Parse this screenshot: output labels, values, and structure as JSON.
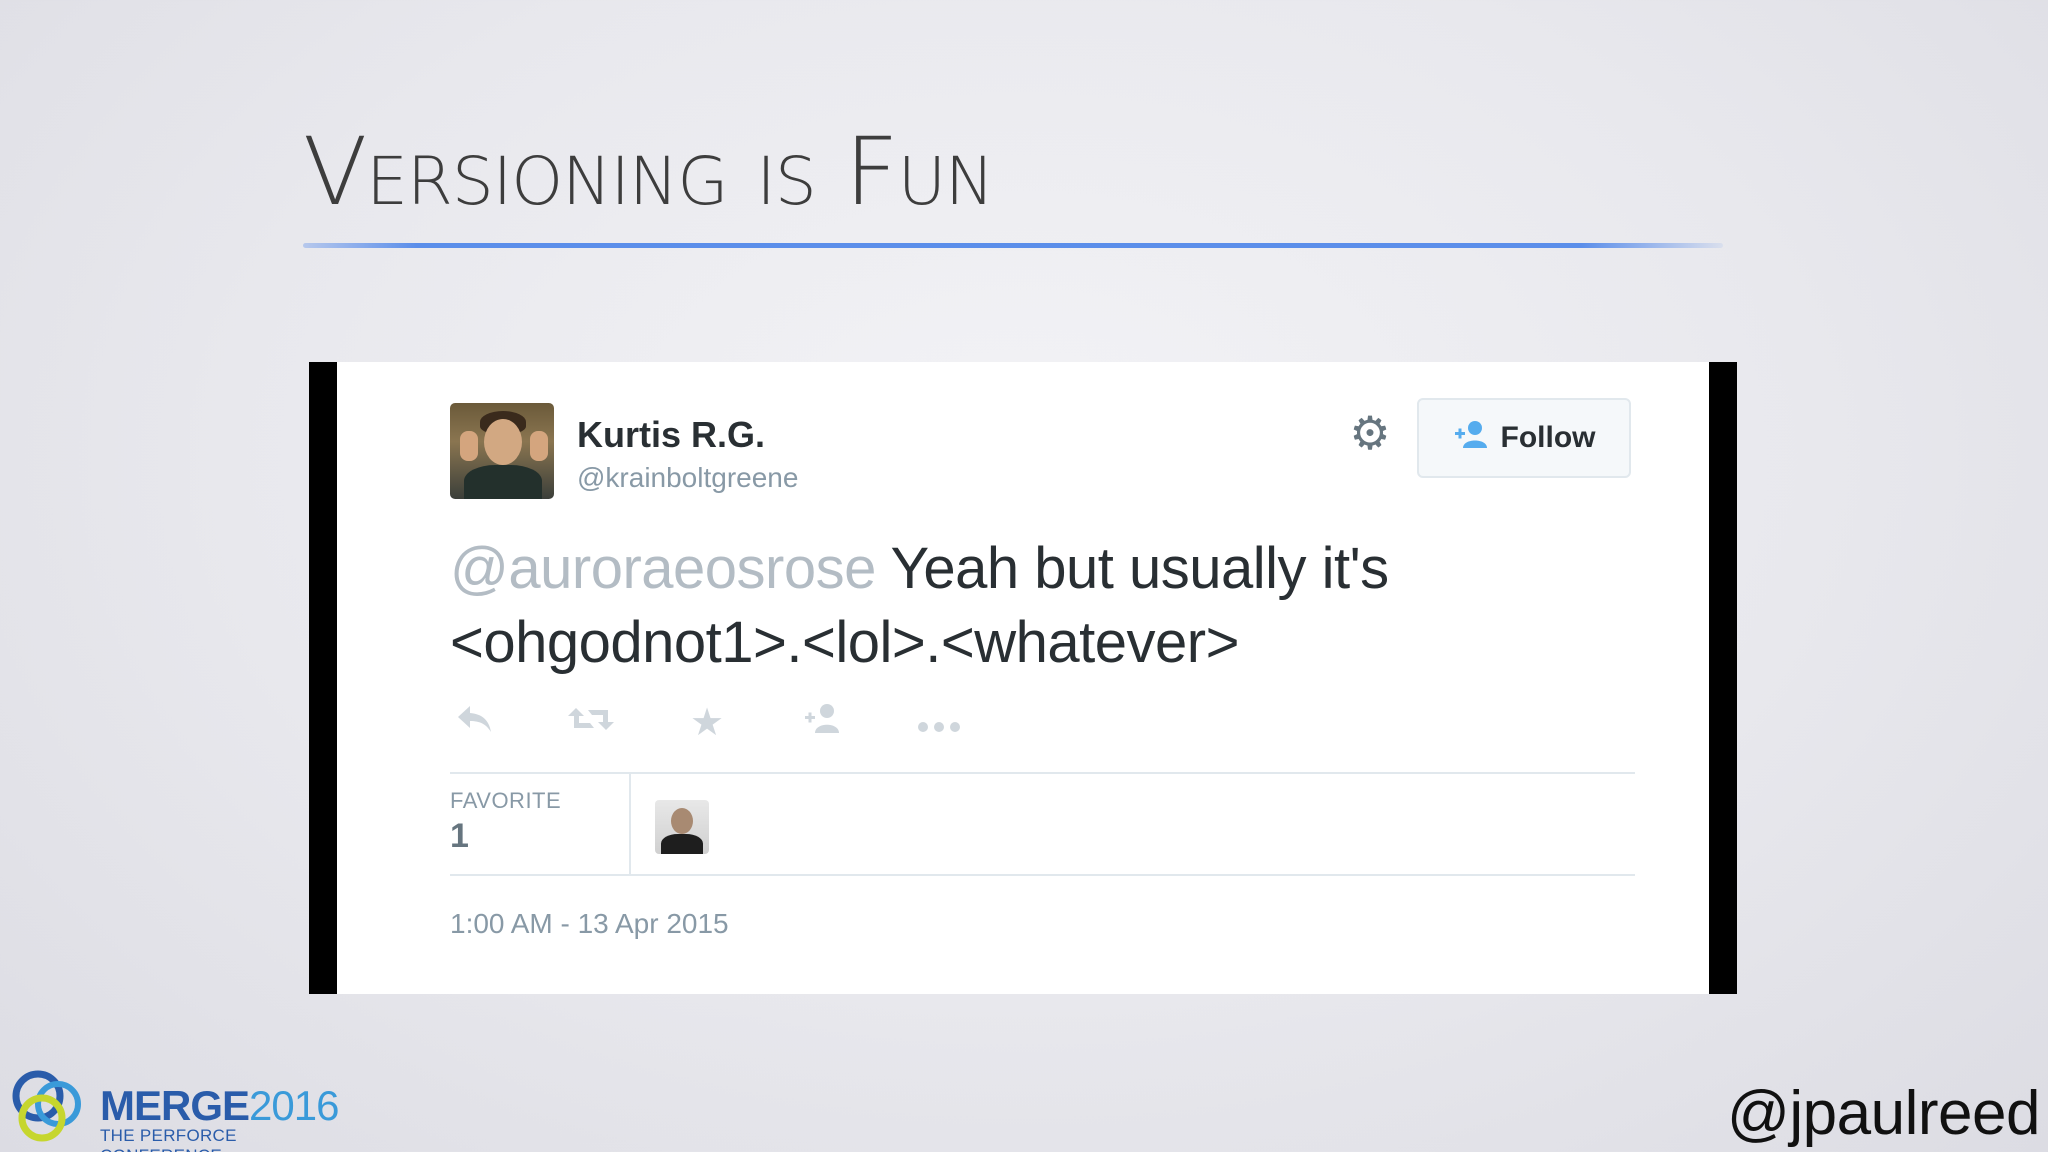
{
  "slide": {
    "title": "Versioning is Fun",
    "handle": "@jpaulreed"
  },
  "tweet": {
    "name": "Kurtis R.G.",
    "username": "@krainboltgreene",
    "follow_label": "Follow",
    "mention": "@auroraeosrose",
    "text_part1": " Yeah but usually it's",
    "text_part2": "<ohgodnot1>.<lol>.<whatever>",
    "favorite_label": "FAVORITE",
    "favorite_count": "1",
    "timestamp": "1:00 AM - 13 Apr 2015",
    "icons": [
      "reply-icon",
      "retweet-icon",
      "favorite-icon",
      "follow-icon",
      "more-icon"
    ]
  },
  "logo": {
    "word": "MERGE",
    "year": "2016",
    "subtitle": "THE PERFORCE CONFERENCE"
  },
  "colors": {
    "title_rule": "#5b8eea",
    "follow_icon": "#55acee",
    "logo_blue": "#2a5caa"
  }
}
